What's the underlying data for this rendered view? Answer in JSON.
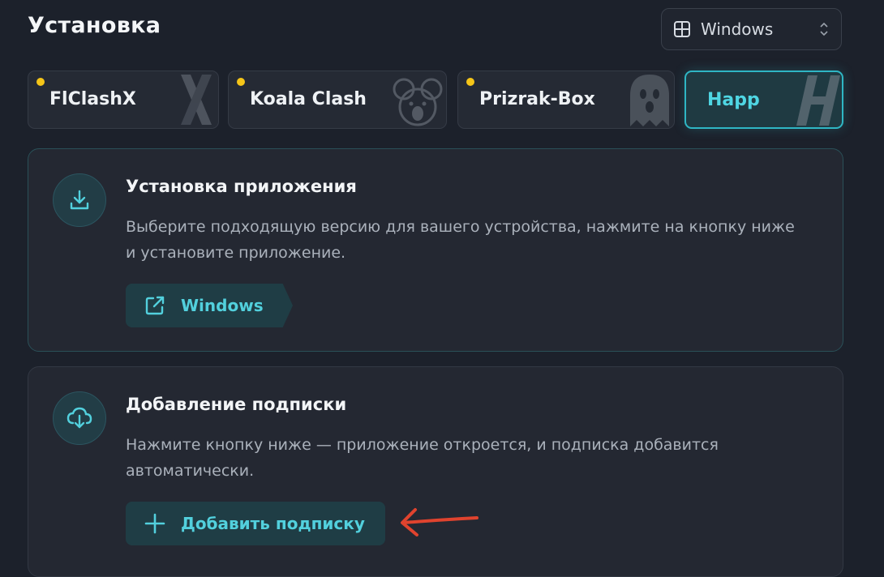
{
  "header": {
    "title": "Установка",
    "os_select": {
      "value": "Windows",
      "icon": "windows-icon"
    }
  },
  "tabs": [
    {
      "label": "FlClashX",
      "badge": true,
      "active": false,
      "icon": "flclashx-logo"
    },
    {
      "label": "Koala Clash",
      "badge": true,
      "active": false,
      "icon": "koala-logo"
    },
    {
      "label": "Prizrak-Box",
      "badge": true,
      "active": false,
      "icon": "ghost-logo"
    },
    {
      "label": "Happ",
      "badge": false,
      "active": true,
      "icon": "happ-logo"
    }
  ],
  "install_card": {
    "title": "Установка приложения",
    "description": "Выберите подходящую версию для вашего устройства, нажмите на кнопку ниже и установите приложение.",
    "button_label": "Windows",
    "icon": "download-icon"
  },
  "subscription_card": {
    "title": "Добавление подписки",
    "description": "Нажмите кнопку ниже — приложение откроется, и подписка добавится автоматически.",
    "button_label": "Добавить подписку",
    "icon": "cloud-download-icon"
  },
  "colors": {
    "accent": "#4fd6e3",
    "badge": "#f5c518",
    "annotation_arrow": "#e0432e",
    "background": "#1c212b"
  }
}
